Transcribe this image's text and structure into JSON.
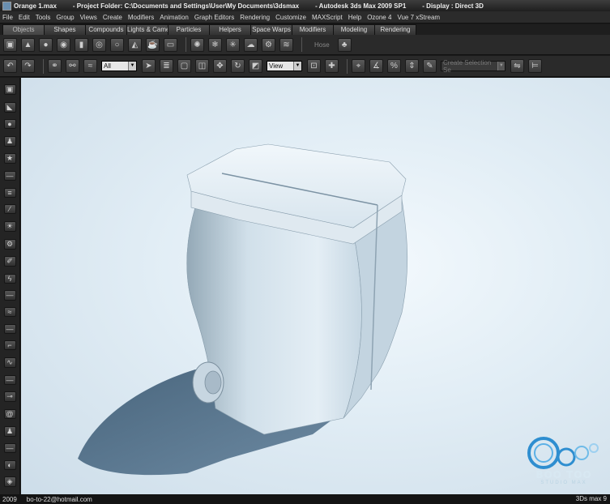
{
  "titlebar": {
    "file": "Orange 1.max",
    "project": "- Project Folder: C:\\Documents and Settings\\User\\My Documents\\3dsmax",
    "app": "- Autodesk 3ds Max  2009 SP1",
    "display": "- Display : Direct 3D"
  },
  "menu": [
    "File",
    "Edit",
    "Tools",
    "Group",
    "Views",
    "Create",
    "Modifiers",
    "Animation",
    "Graph Editors",
    "Rendering",
    "Customize",
    "MAXScript",
    "Help",
    "Ozone 4",
    "Vue 7 xStream"
  ],
  "tabs": [
    "Objects",
    "Shapes",
    "Compounds",
    "Lights & Cameras",
    "Particles",
    "Helpers",
    "Space Warps",
    "Modifiers",
    "Modeling",
    "Rendering"
  ],
  "toolbar_a": {
    "hose_label": "Hose"
  },
  "toolbar_b": {
    "filter_value": "All",
    "view_value": "View",
    "selection_set_placeholder": "Create Selection Se"
  },
  "watermark": {
    "brand": "BOO TOO",
    "sub": "STUDIO MAX"
  },
  "statusbar": {
    "year": "2009",
    "email": "bo-to-22@hotmail.com",
    "right": "3Ds max 9"
  },
  "icons": {
    "toolbar_a": [
      "box-icon",
      "cone-icon",
      "sphere-icon",
      "geosphere-icon",
      "cylinder-icon",
      "tube-icon",
      "torus-icon",
      "pyramid-icon",
      "teapot-icon",
      "plane-icon",
      "sep",
      "spray-icon",
      "snow-icon",
      "blizzard-icon",
      "pcloud-icon",
      "gear-icon",
      "spring-icon",
      "sep",
      "tree-icon"
    ],
    "toolbar_b": [
      "undo-icon",
      "redo-icon",
      "sep",
      "link-icon",
      "unlink-icon",
      "bind-space-warp-icon"
    ],
    "side": [
      "box-icon",
      "wedge-icon",
      "sphere-icon",
      "figure-icon",
      "star-icon",
      "dash",
      "stack-icon",
      "wand-icon",
      "sun-icon",
      "gear-icon",
      "brush-icon",
      "lightning-icon",
      "dash",
      "waves-icon",
      "dash",
      "hook-icon",
      "warp-icon",
      "dash",
      "bone-icon",
      "spiral-icon",
      "figure-icon",
      "dash",
      "eye-icon",
      "cube-icon"
    ]
  },
  "colors": {
    "viewport_bg": "#dfeaf2",
    "ui_dark": "#2a2a2a",
    "menu_text": "#dddddd",
    "watermark_blue": "#2e8ed0"
  }
}
